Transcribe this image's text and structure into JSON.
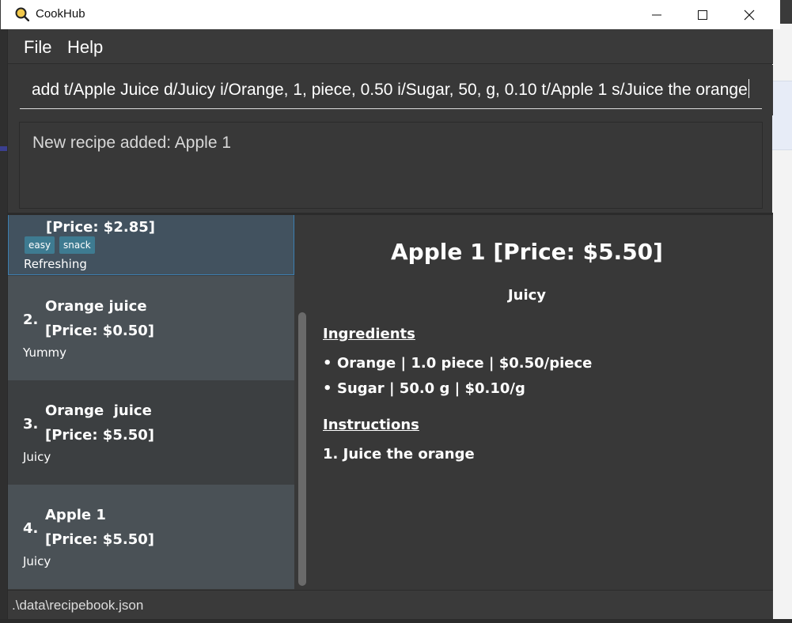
{
  "window": {
    "title": "CookHub"
  },
  "menu": {
    "file": "File",
    "help": "Help"
  },
  "command": {
    "value": "add t/Apple Juice d/Juicy i/Orange, 1, piece, 0.50 i/Sugar, 50, g, 0.10 t/Apple 1 s/Juice the orange"
  },
  "result": {
    "text": "New recipe added: Apple 1"
  },
  "recipe_list": {
    "items": [
      {
        "index": "",
        "name": "",
        "price": "[Price: $2.85]",
        "tags": [
          "easy",
          "snack"
        ],
        "description": "Refreshing",
        "selected": true
      },
      {
        "index": "2.",
        "name": "Orange juice",
        "price": "[Price: $0.50]",
        "tags": [],
        "description": "Yummy"
      },
      {
        "index": "3.",
        "name": "Orange  juice",
        "price": "[Price: $5.50]",
        "tags": [],
        "description": "Juicy"
      },
      {
        "index": "4.",
        "name": "Apple 1",
        "price": "[Price: $5.50]",
        "tags": [],
        "description": "Juicy"
      }
    ]
  },
  "detail": {
    "title": "Apple 1 [Price: $5.50]",
    "description": "Juicy",
    "ingredients_heading": "Ingredients",
    "ingredients": [
      "Orange | 1.0 piece | $0.50/piece",
      "Sugar | 50.0 g | $0.10/g"
    ],
    "instructions_heading": "Instructions",
    "instructions": [
      {
        "num": "1.",
        "text": "Juice the orange"
      }
    ]
  },
  "status": {
    "path": ".\\data\\recipebook.json"
  },
  "icons": {
    "app": "magnifier-pan-icon",
    "minimize": "minimize-icon",
    "maximize": "maximize-icon",
    "close": "close-icon"
  },
  "colors": {
    "accent_tag": "#3e7b91",
    "selected_border": "#3c7fb1",
    "panel_bg": "#383838"
  }
}
